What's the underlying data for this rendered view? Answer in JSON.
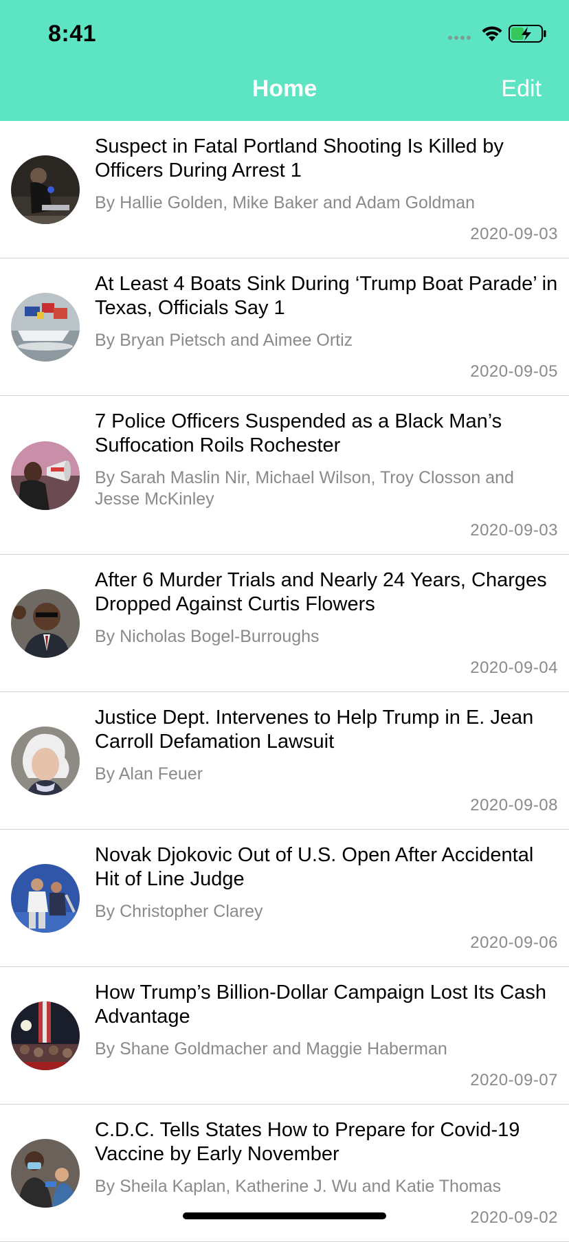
{
  "status_bar": {
    "time": "8:41"
  },
  "nav": {
    "title": "Home",
    "edit_label": "Edit"
  },
  "colors": {
    "header": "#5de4c3",
    "title_text": "#ffffff",
    "meta_text": "#8a8a8a"
  },
  "articles": [
    {
      "title": "Suspect in Fatal Portland Shooting Is Killed by Officers During Arrest 1",
      "author": "By Hallie Golden, Mike Baker and Adam Goldman",
      "date": "2020-09-03"
    },
    {
      "title": "At Least 4 Boats Sink During ‘Trump Boat Parade’ in Texas, Officials Say 1",
      "author": "By Bryan Pietsch and Aimee Ortiz",
      "date": "2020-09-05"
    },
    {
      "title": "7 Police Officers Suspended as a Black Man’s Suffocation Roils Rochester",
      "author": "By Sarah Maslin Nir, Michael Wilson, Troy Closson and Jesse McKinley",
      "date": "2020-09-03"
    },
    {
      "title": "After 6 Murder Trials and Nearly 24 Years, Charges Dropped Against Curtis Flowers",
      "author": "By Nicholas Bogel-Burroughs",
      "date": "2020-09-04"
    },
    {
      "title": "Justice Dept. Intervenes to Help Trump in E. Jean Carroll Defamation Lawsuit",
      "author": "By Alan Feuer",
      "date": "2020-09-08"
    },
    {
      "title": "Novak Djokovic Out of U.S. Open After Accidental Hit of Line Judge",
      "author": "By Christopher Clarey",
      "date": "2020-09-06"
    },
    {
      "title": "How Trump’s Billion-Dollar Campaign Lost Its Cash Advantage",
      "author": "By Shane Goldmacher and Maggie Haberman",
      "date": "2020-09-07"
    },
    {
      "title": "C.D.C. Tells States How to Prepare for Covid-19 Vaccine by Early November",
      "author": "By Sheila Kaplan, Katherine J. Wu and Katie Thomas",
      "date": "2020-09-02"
    }
  ]
}
